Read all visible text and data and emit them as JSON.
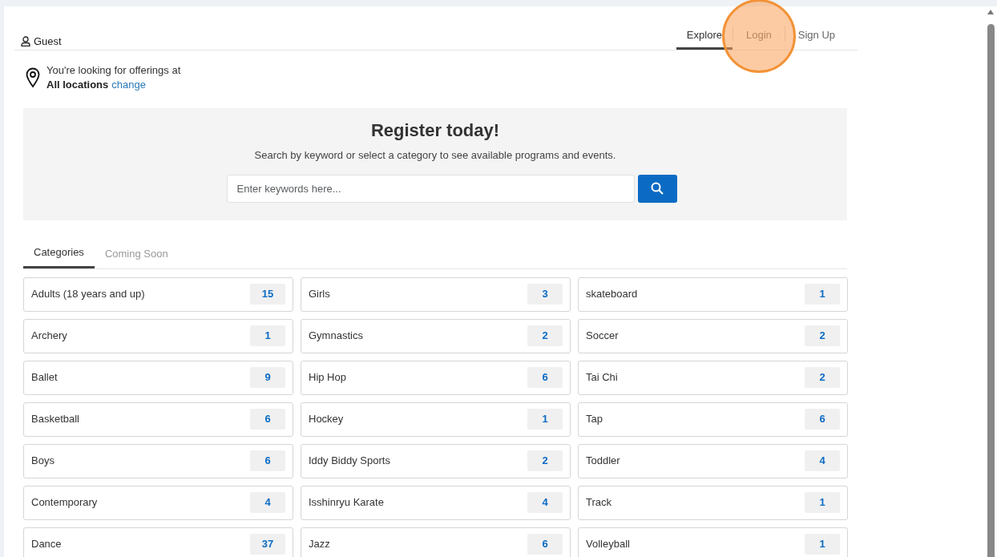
{
  "user": {
    "label": "Guest"
  },
  "nav": [
    {
      "label": "Explore",
      "selected": true,
      "highlighted": false
    },
    {
      "label": "Login",
      "selected": false,
      "highlighted": true
    },
    {
      "label": "Sign Up",
      "selected": false,
      "highlighted": false
    }
  ],
  "location": {
    "intro": "You're looking for offerings at",
    "value": "All locations",
    "link": "change"
  },
  "hero": {
    "title": "Register today!",
    "subtitle": "Search by keyword or select a category to see available programs and events.",
    "search": {
      "placeholder": "Enter keywords here..."
    }
  },
  "tabs": [
    {
      "label": "Categories",
      "selected": true
    },
    {
      "label": "Coming Soon",
      "selected": false
    }
  ],
  "categories": [
    {
      "name": "Adults (18 years and up)",
      "count": "15"
    },
    {
      "name": "Girls",
      "count": "3"
    },
    {
      "name": "skateboard",
      "count": "1"
    },
    {
      "name": "Archery",
      "count": "1"
    },
    {
      "name": "Gymnastics",
      "count": "2"
    },
    {
      "name": "Soccer",
      "count": "2"
    },
    {
      "name": "Ballet",
      "count": "9"
    },
    {
      "name": "Hip Hop",
      "count": "6"
    },
    {
      "name": "Tai Chi",
      "count": "2"
    },
    {
      "name": "Basketball",
      "count": "6"
    },
    {
      "name": "Hockey",
      "count": "1"
    },
    {
      "name": "Tap",
      "count": "6"
    },
    {
      "name": "Boys",
      "count": "6"
    },
    {
      "name": "Iddy Biddy Sports",
      "count": "2"
    },
    {
      "name": "Toddler",
      "count": "4"
    },
    {
      "name": "Contemporary",
      "count": "4"
    },
    {
      "name": "Isshinryu Karate",
      "count": "4"
    },
    {
      "name": "Track",
      "count": "1"
    },
    {
      "name": "Dance",
      "count": "37"
    },
    {
      "name": "Jazz",
      "count": "6"
    },
    {
      "name": "Volleyball",
      "count": "1"
    }
  ]
}
